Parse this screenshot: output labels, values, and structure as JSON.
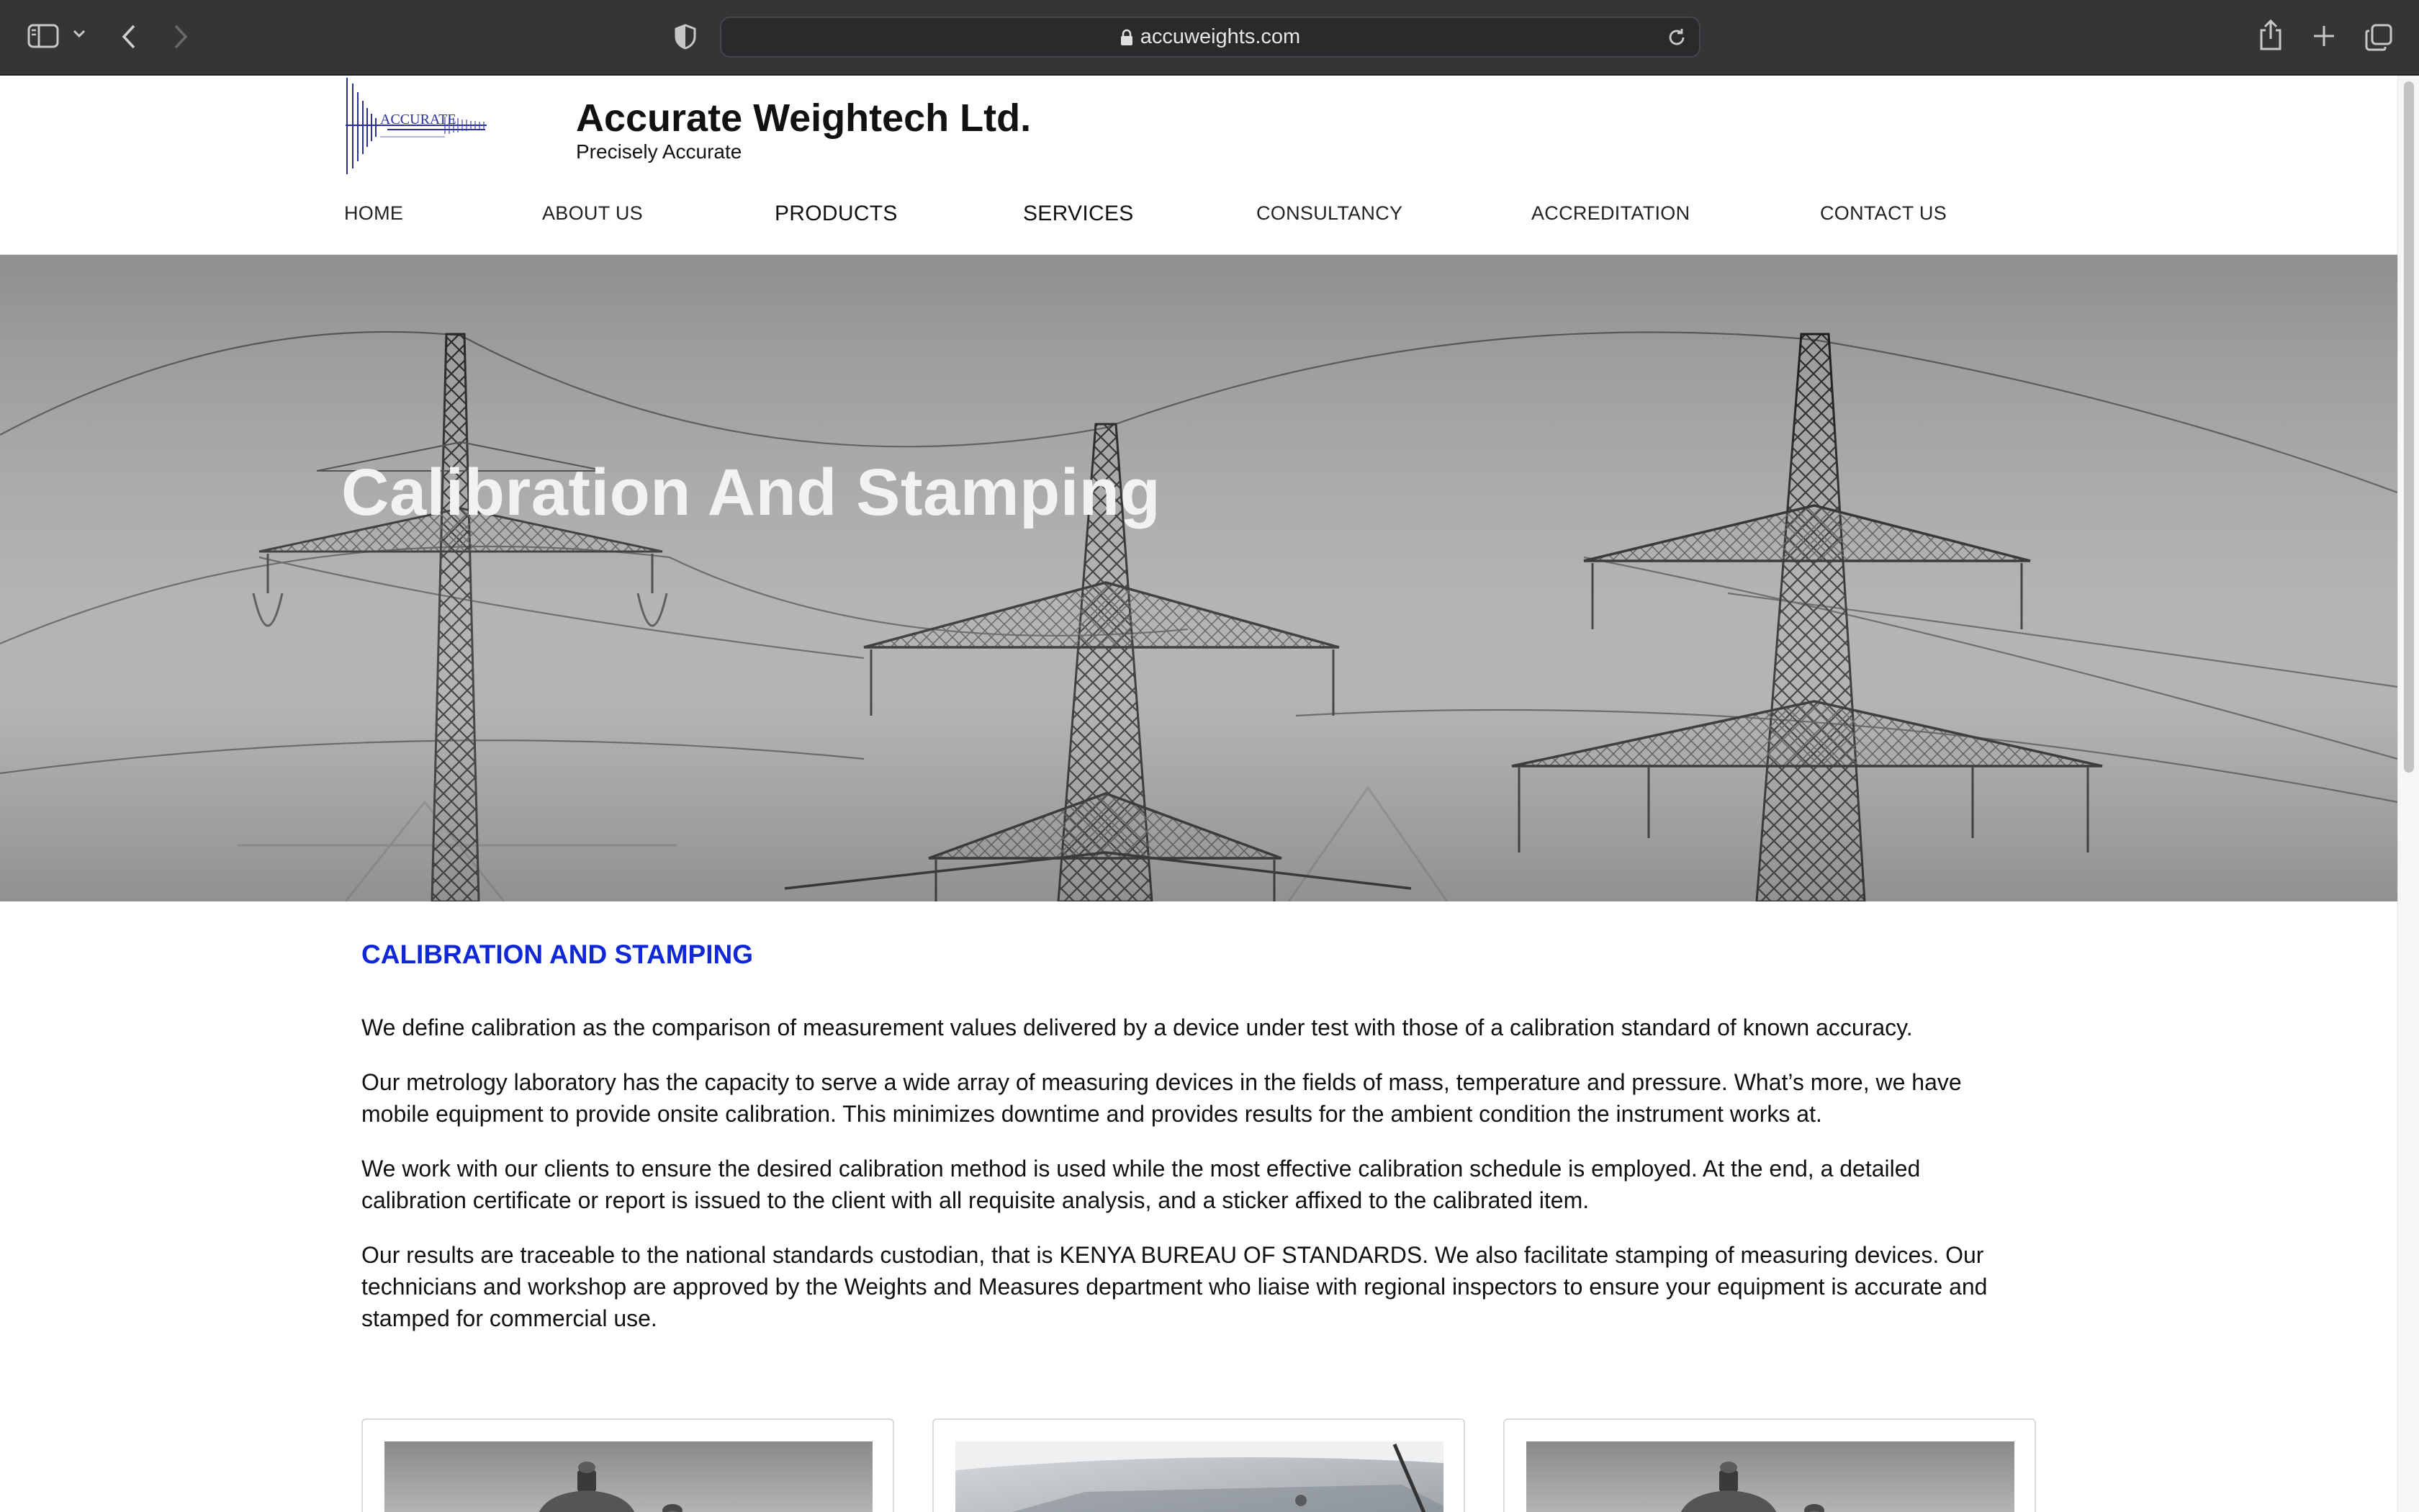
{
  "browser": {
    "url": "accuweights.com",
    "icons": {
      "sidebar": "sidebar-icon",
      "chevron": "chevron-down-icon",
      "back": "back-arrow-icon",
      "forward": "forward-arrow-icon",
      "shield": "privacy-shield-icon",
      "lock": "lock-icon",
      "reload": "reload-icon",
      "share": "share-icon",
      "new_tab": "plus-icon",
      "tabs": "tabs-overview-icon"
    }
  },
  "header": {
    "logo_text": "ACCURATE",
    "title": "Accurate Weightech Ltd.",
    "tagline": "Precisely Accurate"
  },
  "nav": {
    "items": [
      {
        "label": "HOME"
      },
      {
        "label": "ABOUT US"
      },
      {
        "label": "PRODUCTS"
      },
      {
        "label": "SERVICES"
      },
      {
        "label": "CONSULTANCY"
      },
      {
        "label": "ACCREDITATION"
      },
      {
        "label": "CONTACT US"
      }
    ]
  },
  "hero": {
    "title": "Calibration And Stamping"
  },
  "content": {
    "heading": "CALIBRATION AND STAMPING",
    "paragraphs": [
      "We define calibration as the comparison of measurement values delivered by a device under test with those of a calibration standard of known accuracy.",
      "Our metrology laboratory has the capacity to serve a wide array of measuring devices in the fields of mass, temperature and pressure. What’s more, we have mobile equipment to provide onsite calibration. This minimizes downtime and provides results for the ambient condition the instrument works at.",
      "We work with our clients to ensure the desired calibration method is used while the most effective calibration schedule is employed. At the end, a detailed calibration certificate or report is issued to the client with all requisite analysis, and a sticker affixed to the calibrated item.",
      "Our results are traceable to the national standards custodian, that is KENYA BUREAU OF STANDARDS. We also facilitate stamping of measuring devices. Our technicians and workshop are approved by the Weights and Measures department who liaise with regional inspectors to ensure your equipment is accurate and stamped for commercial use."
    ]
  },
  "colors": {
    "accent": "#1027d6",
    "browser_toolbar": "#353538",
    "hero_grey": "#a2a2a2"
  }
}
